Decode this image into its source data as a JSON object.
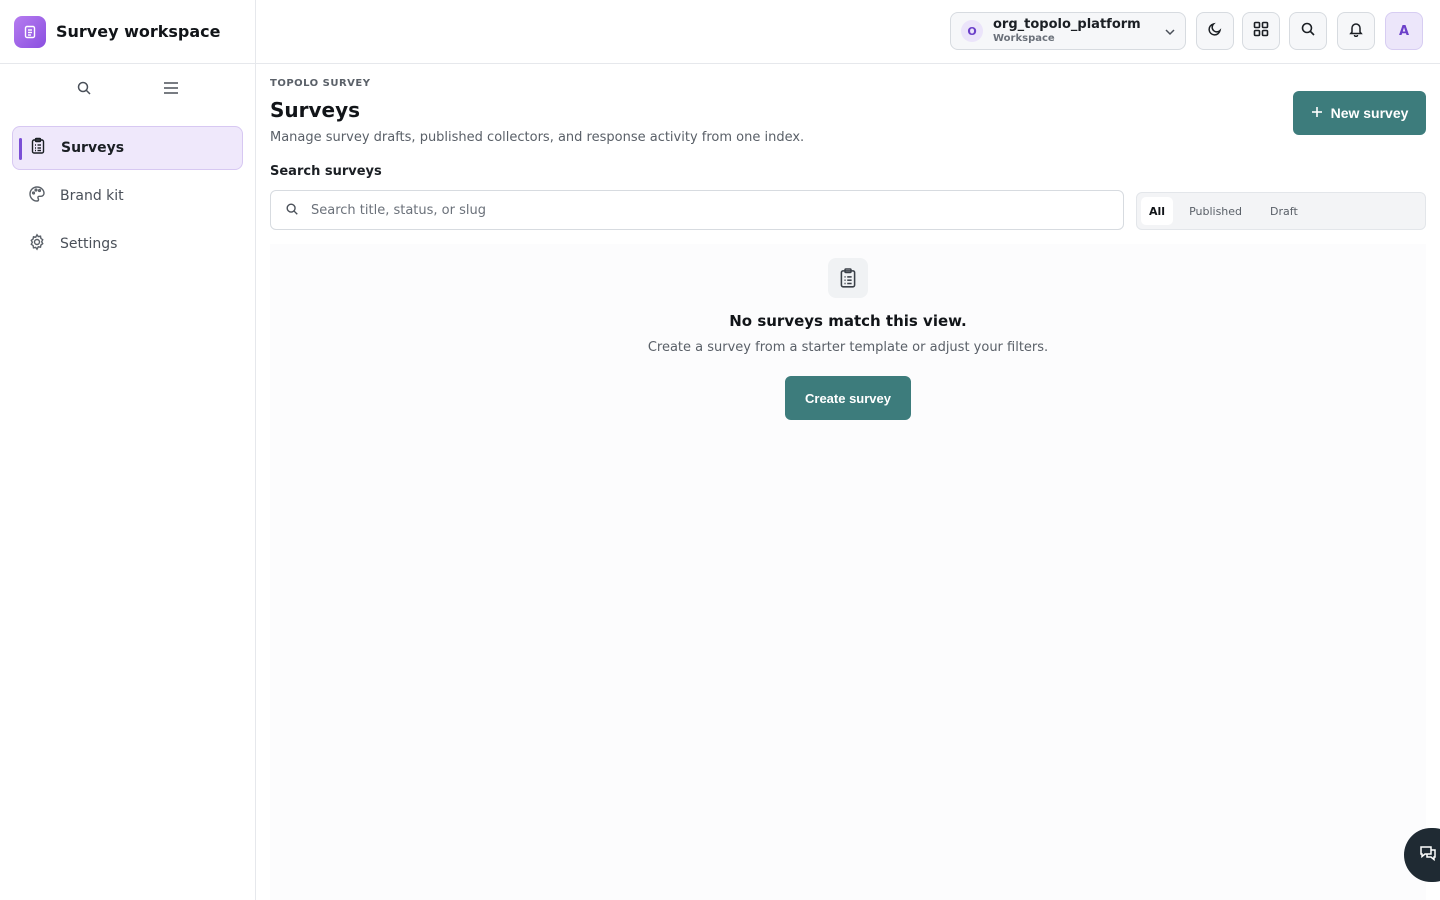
{
  "app": {
    "title": "Survey workspace",
    "logo_icon": "clipboard-icon"
  },
  "sidebar": {
    "tools": [
      {
        "icon": "search-icon"
      },
      {
        "icon": "menu-icon"
      }
    ],
    "items": [
      {
        "label": "Surveys",
        "icon": "clipboard-icon",
        "active": true
      },
      {
        "label": "Brand kit",
        "icon": "palette-icon",
        "active": false
      },
      {
        "label": "Settings",
        "icon": "gear-icon",
        "active": false
      }
    ]
  },
  "topbar": {
    "org": {
      "initial": "O",
      "name": "org_topolo_platform",
      "subtitle": "Workspace"
    },
    "icons": [
      "moon-icon",
      "apps-grid-icon",
      "search-icon",
      "bell-icon"
    ],
    "user_initial": "A"
  },
  "main": {
    "eyebrow": "TOPOLO SURVEY",
    "title": "Surveys",
    "subtitle": "Manage survey drafts, published collectors, and response activity from one index.",
    "new_button": "New survey",
    "search": {
      "label": "Search surveys",
      "placeholder": "Search title, status, or slug",
      "value": ""
    },
    "filters": [
      {
        "label": "All",
        "active": true
      },
      {
        "label": "Published",
        "active": false
      },
      {
        "label": "Draft",
        "active": false
      }
    ],
    "empty": {
      "title": "No surveys match this view.",
      "subtitle": "Create a survey from a starter template or adjust your filters.",
      "button": "Create survey"
    }
  },
  "colors": {
    "accent": "#3d7c7c",
    "brand": "#8a4fe0",
    "active_nav_bg": "#efe8fb"
  }
}
